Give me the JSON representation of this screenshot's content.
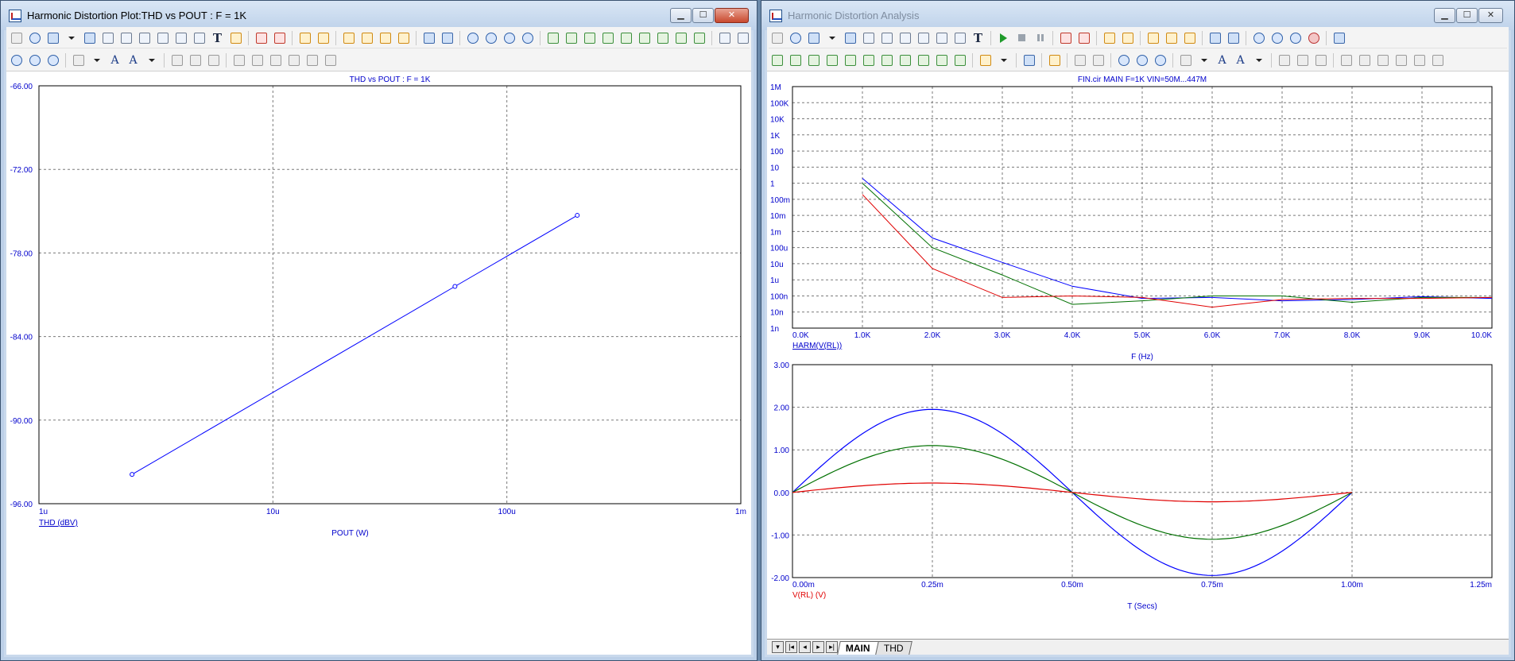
{
  "left_window": {
    "title": "Harmonic Distortion Plot:THD vs POUT : F = 1K",
    "chart_data": {
      "type": "line",
      "title": "THD vs POUT : F = 1K",
      "xlabel": "POUT (W)",
      "ylabel": "THD (dBV)",
      "x_scale": "log",
      "xlim": [
        1e-06,
        0.001
      ],
      "ylim": [
        -96,
        -66
      ],
      "x_ticks": [
        "1u",
        "10u",
        "100u",
        "1m"
      ],
      "y_ticks": [
        "-66.00",
        "-72.00",
        "-78.00",
        "-84.00",
        "-90.00",
        "-96.00"
      ],
      "grid": true,
      "series": [
        {
          "name": "THD (dBV)",
          "color": "#0000ff",
          "x": [
            2.5e-06,
            6e-05,
            0.0002
          ],
          "y": [
            -93.9,
            -80.4,
            -75.3
          ]
        }
      ]
    }
  },
  "right_window": {
    "title": "Harmonic Distortion Analysis",
    "tabs": [
      "MAIN",
      "THD"
    ],
    "active_tab": "MAIN",
    "chart_data": [
      {
        "type": "line",
        "title": "FIN.cir MAIN F=1K VIN=50M...447M",
        "xlabel": "F (Hz)",
        "ylabel": "HARM(V(RL))",
        "y_scale": "log",
        "xlim": [
          0,
          10000
        ],
        "ylim": [
          1e-09,
          1000000.0
        ],
        "x_ticks": [
          "0.0K",
          "1.0K",
          "2.0K",
          "3.0K",
          "4.0K",
          "5.0K",
          "6.0K",
          "7.0K",
          "8.0K",
          "9.0K",
          "10.0K"
        ],
        "y_ticks": [
          "1M",
          "100K",
          "10K",
          "1K",
          "100",
          "10",
          "1",
          "100m",
          "10m",
          "1m",
          "100u",
          "10u",
          "1u",
          "100n",
          "10n",
          "1n"
        ],
        "grid": true,
        "series": [
          {
            "color": "#0000ff",
            "x": [
              1000,
              2000,
              3000,
              4000,
              5000,
              6000,
              7000,
              8000,
              9000,
              10000
            ],
            "y": [
              2.0,
              0.0004,
              1.2e-05,
              4e-07,
              7e-08,
              8e-08,
              5e-08,
              6e-08,
              9e-08,
              7e-08
            ]
          },
          {
            "color": "#007000",
            "x": [
              1000,
              2000,
              3000,
              4000,
              5000,
              6000,
              7000,
              8000,
              9000,
              10000
            ],
            "y": [
              1.0,
              0.0001,
              2e-06,
              3e-08,
              5e-08,
              1e-07,
              1e-07,
              4e-08,
              8e-08,
              8e-08
            ]
          },
          {
            "color": "#e00000",
            "x": [
              1000,
              2000,
              3000,
              4000,
              5000,
              6000,
              7000,
              8000,
              9000,
              10000
            ],
            "y": [
              0.2,
              5e-06,
              8e-08,
              1e-07,
              8e-08,
              2e-08,
              6e-08,
              7e-08,
              7e-08,
              8e-08
            ]
          }
        ]
      },
      {
        "type": "line",
        "title": "",
        "xlabel": "T (Secs)",
        "ylabel": "V(RL) (V)",
        "xlim": [
          0,
          0.00125
        ],
        "ylim": [
          -2,
          3
        ],
        "x_ticks": [
          "0.00m",
          "0.25m",
          "0.50m",
          "0.75m",
          "1.00m",
          "1.25m"
        ],
        "y_ticks": [
          "3.00",
          "2.00",
          "1.00",
          "0.00",
          "-1.00",
          "-2.00"
        ],
        "grid": true,
        "series": [
          {
            "color": "#0000ff",
            "waveform": "sine",
            "amplitude": 1.95,
            "period": 0.001,
            "x_start": 0,
            "x_end": 0.001
          },
          {
            "color": "#007000",
            "waveform": "sine",
            "amplitude": 1.1,
            "period": 0.001,
            "x_start": 0,
            "x_end": 0.001
          },
          {
            "color": "#e00000",
            "waveform": "sine",
            "amplitude": 0.22,
            "period": 0.001,
            "x_start": 0,
            "x_end": 0.001
          }
        ]
      }
    ]
  },
  "toolbar": {
    "text_tool_glyph": "T",
    "font_tool_glyph": "A",
    "font_tool_glyph_2": "A"
  },
  "colors": {
    "plot_text": "#0000cc",
    "grid": "#7a7a7a",
    "window_frame": "#c9d9ec"
  }
}
